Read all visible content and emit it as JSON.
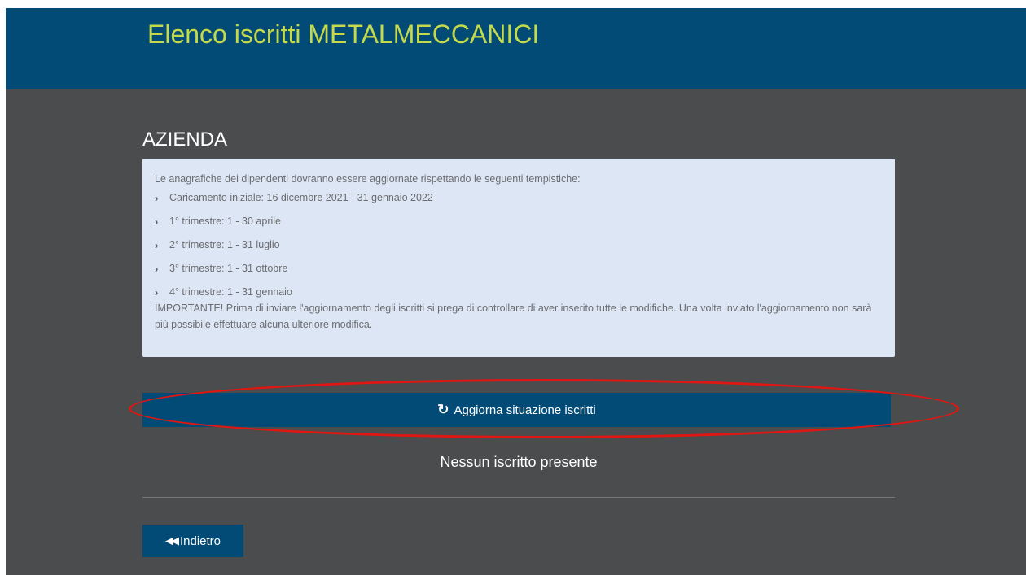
{
  "header": {
    "title": "Elenco iscritti METALMECCANICI"
  },
  "section": {
    "title": "AZIENDA"
  },
  "info": {
    "intro": "Le anagrafiche dei dipendenti dovranno essere aggiornate rispettando le seguenti tempistiche:",
    "items": [
      "Caricamento iniziale: 16 dicembre 2021 - 31 gennaio 2022",
      "1° trimestre: 1 - 30 aprile",
      "2° trimestre: 1 - 31 luglio",
      "3° trimestre: 1 - 31 ottobre",
      "4° trimestre: 1 - 31 gennaio"
    ],
    "important": "IMPORTANTE! Prima di inviare l'aggiornamento degli iscritti si prega di controllare di aver inserito tutte le modifiche. Una volta inviato l'aggiornamento non sarà più possibile effettuare alcuna ulteriore modifica."
  },
  "actions": {
    "update_label": "Aggiorna situazione iscritti",
    "update_icon": "refresh-icon",
    "back_label": "Indietro",
    "back_icon": "backward-icon"
  },
  "status": {
    "empty_message": "Nessun iscritto presente"
  },
  "colors": {
    "header_bg": "#014b76",
    "title_color": "#c5d94a",
    "body_bg": "#4b4c4e",
    "info_bg": "#dde6f4",
    "highlight": "#e01612"
  }
}
